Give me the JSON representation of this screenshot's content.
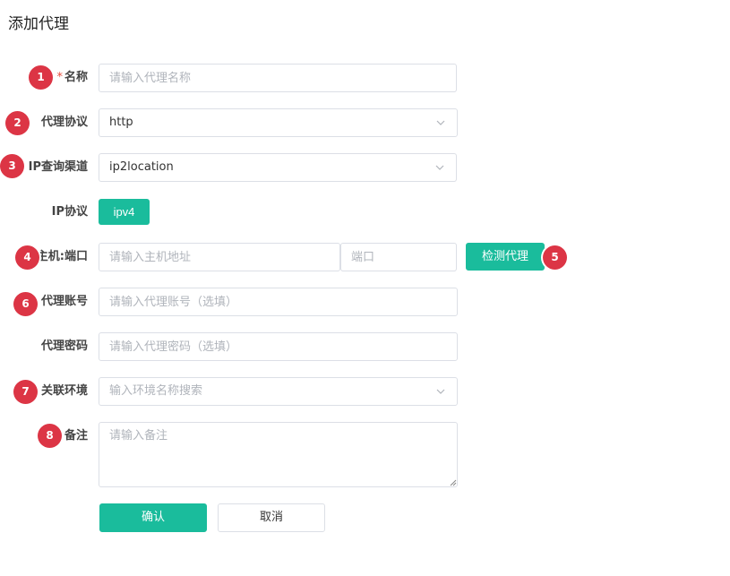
{
  "page": {
    "title": "添加代理"
  },
  "form": {
    "name": {
      "label": "名称",
      "required_mark": "*",
      "placeholder": "请输入代理名称",
      "value": ""
    },
    "protocol": {
      "label": "代理协议",
      "value": "http"
    },
    "ip_channel": {
      "label": "IP查询渠道",
      "value": "ip2location"
    },
    "ip_protocol": {
      "label": "IP协议",
      "option": "ipv4"
    },
    "host_port": {
      "label": "主机:端口",
      "host_placeholder": "请输入主机地址",
      "port_placeholder": "端口",
      "check_button": "检测代理"
    },
    "account": {
      "label": "代理账号",
      "placeholder": "请输入代理账号（选填）"
    },
    "password": {
      "label": "代理密码",
      "placeholder": "请输入代理密码（选填）"
    },
    "environment": {
      "label": "关联环境",
      "placeholder": "输入环境名称搜索"
    },
    "remark": {
      "label": "备注",
      "placeholder": "请输入备注"
    },
    "buttons": {
      "confirm": "确认",
      "cancel": "取消"
    }
  },
  "badges": [
    "1",
    "2",
    "3",
    "4",
    "5",
    "6",
    "7",
    "8"
  ],
  "colors": {
    "accent": "#1abc9c",
    "badge": "#dc3545",
    "required": "#e74c3c"
  },
  "icons": {
    "select_arrow": "chevron-down-icon",
    "textarea_grip": "resize-grip-icon"
  }
}
